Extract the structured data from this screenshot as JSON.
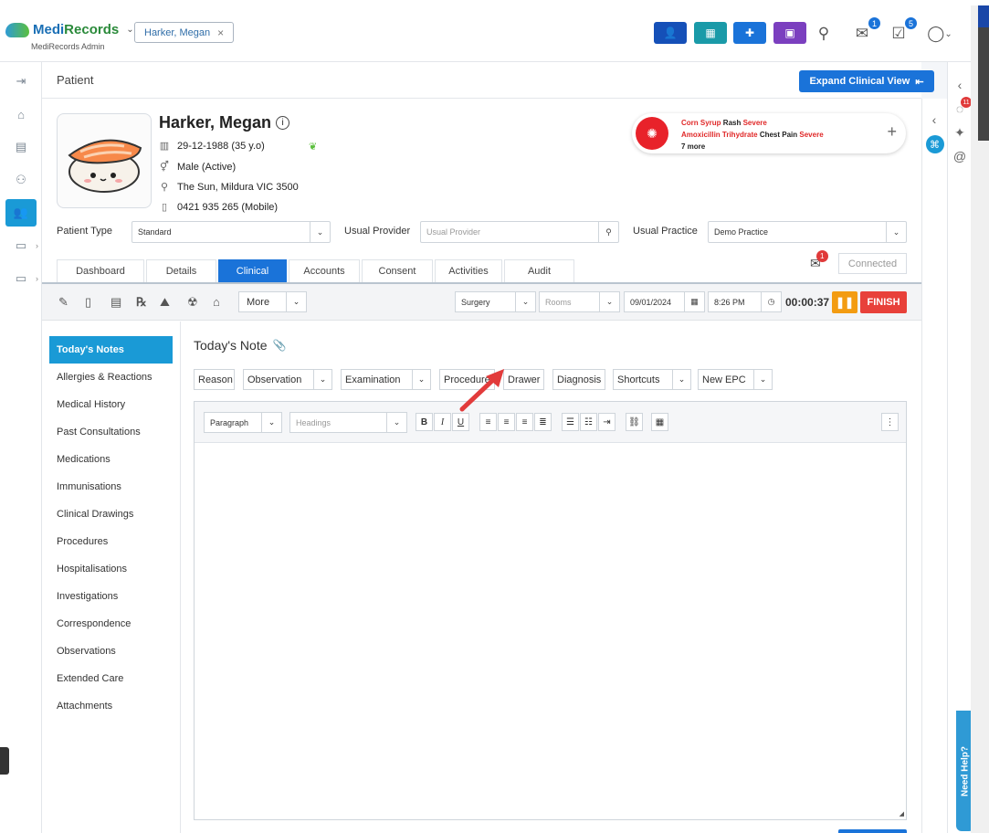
{
  "app": {
    "logo_medi": "Medi",
    "logo_records": "Records",
    "subtitle": "MediRecords Admin"
  },
  "open_patient_tab": "Harker, Megan",
  "header": {
    "mail_badge": "1",
    "tasks_badge": "5"
  },
  "page": {
    "title": "Patient",
    "expand_button": "Expand Clinical View"
  },
  "patient": {
    "name": "Harker, Megan",
    "dob": "29-12-1988 (35 y.o)",
    "gender": "Male (Active)",
    "address": "The Sun, Mildura VIC 3500",
    "phone": "0421 935 265 (Mobile)"
  },
  "allergies": {
    "line1_agent": "Corn Syrup",
    "line1_reaction": "Rash",
    "line1_severity": "Severe",
    "line2_agent": "Amoxicillin Trihydrate",
    "line2_reaction": "Chest Pain",
    "line2_severity": "Severe",
    "more": "7 more"
  },
  "fields": {
    "patient_type_label": "Patient Type",
    "patient_type_value": "Standard",
    "usual_provider_label": "Usual Provider",
    "usual_provider_placeholder": "Usual Provider",
    "usual_practice_label": "Usual Practice",
    "usual_practice_value": "Demo Practice"
  },
  "tabs": [
    "Dashboard",
    "Details",
    "Clinical",
    "Accounts",
    "Consent",
    "Activities",
    "Audit"
  ],
  "messages_badge": "1",
  "connected_label": "Connected",
  "toolbar": {
    "more_label": "More",
    "location_value": "Surgery",
    "rooms_placeholder": "Rooms",
    "date_value": "09/01/2024",
    "time_value": "8:26 PM",
    "timer": "00:00:37",
    "finish_label": "FINISH"
  },
  "side_menu": [
    "Today's Notes",
    "Allergies & Reactions",
    "Medical History",
    "Past Consultations",
    "Medications",
    "Immunisations",
    "Clinical Drawings",
    "Procedures",
    "Hospitalisations",
    "Investigations",
    "Correspondence",
    "Observations",
    "Extended Care",
    "Attachments"
  ],
  "note": {
    "title": "Today's Note",
    "buttons": {
      "reason": "Reason",
      "observation": "Observation",
      "examination": "Examination",
      "procedure": "Procedure",
      "drawer": "Drawer",
      "diagnosis": "Diagnosis",
      "shortcuts": "Shortcuts",
      "new_epc": "New EPC"
    },
    "editor": {
      "format_value": "Paragraph",
      "headings_placeholder": "Headings"
    }
  },
  "right_panel": {
    "notif_badge": "11",
    "need_help": "Need Help?"
  },
  "colors": {
    "primary": "#1a73d9",
    "accent": "#1a9ad6",
    "danger": "#e8413a",
    "warning": "#f39c12"
  }
}
